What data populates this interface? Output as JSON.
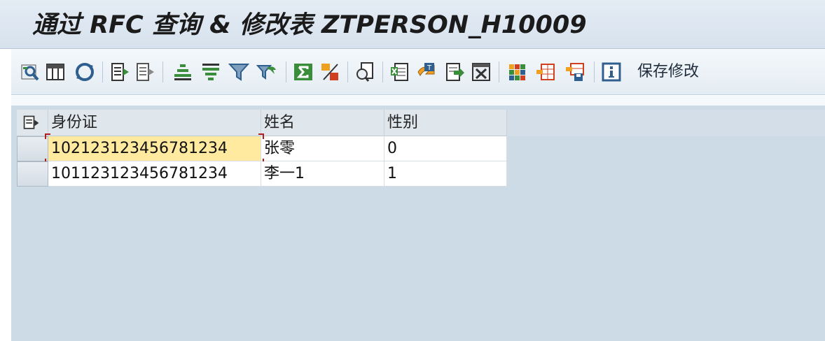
{
  "window": {
    "title": "通过 RFC 查询 & 修改表 ZTPERSON_H10009"
  },
  "toolbar": {
    "buttons": [
      {
        "icon": "details-icon"
      },
      {
        "icon": "layout-icon"
      },
      {
        "icon": "refresh-icon"
      },
      {
        "icon": "check-entries-icon"
      },
      {
        "icon": "cancel-entries-icon"
      },
      {
        "icon": "sort-ascending-icon"
      },
      {
        "icon": "sort-descending-icon"
      },
      {
        "icon": "filter-icon"
      },
      {
        "icon": "delete-filter-icon"
      },
      {
        "icon": "sum-icon"
      },
      {
        "icon": "subtotal-icon"
      },
      {
        "icon": "print-preview-icon"
      },
      {
        "icon": "export-excel-icon"
      },
      {
        "icon": "word-processing-icon"
      },
      {
        "icon": "local-file-icon"
      },
      {
        "icon": "abc-analysis-icon"
      },
      {
        "icon": "choose-layout-icon"
      },
      {
        "icon": "change-layout-icon"
      },
      {
        "icon": "save-layout-icon"
      },
      {
        "icon": "info-icon"
      }
    ],
    "save_label": "保存修改"
  },
  "grid": {
    "columns": [
      "身份证",
      "姓名",
      "性别"
    ],
    "rows": [
      [
        "102123123456781234",
        "张零",
        "0"
      ],
      [
        "101123123456781234",
        "李一1",
        "1"
      ]
    ]
  },
  "colors": {
    "background": "#cddbe7",
    "header": "#dfe6ec",
    "focused_cell": "#ffeaa0",
    "icon_green": "#3a8d3a",
    "icon_blue": "#2f5f8f"
  }
}
